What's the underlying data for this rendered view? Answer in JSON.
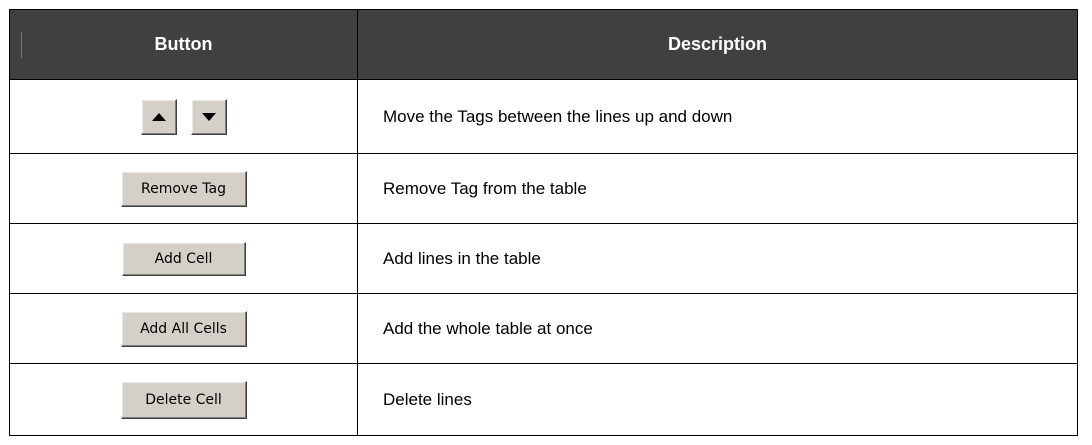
{
  "table": {
    "header": {
      "button_col": "Button",
      "description_col": "Description"
    },
    "rows": [
      {
        "button": {
          "type": "arrows",
          "icons": [
            "arrow-up-icon",
            "arrow-down-icon"
          ]
        },
        "description": "Move the Tags between the lines up and down"
      },
      {
        "button": {
          "type": "text",
          "label": "Remove Tag"
        },
        "description": "Remove Tag from the table"
      },
      {
        "button": {
          "type": "text",
          "label": "Add Cell"
        },
        "description": "Add lines in the table"
      },
      {
        "button": {
          "type": "text",
          "label": "Add All Cells"
        },
        "description": "Add the whole table at once"
      },
      {
        "button": {
          "type": "text",
          "label": "Delete Cell"
        },
        "description": "Delete lines"
      }
    ]
  },
  "colors": {
    "header_bg": "#404040",
    "header_text": "#ffffff",
    "button_face": "#d4d0c8"
  }
}
